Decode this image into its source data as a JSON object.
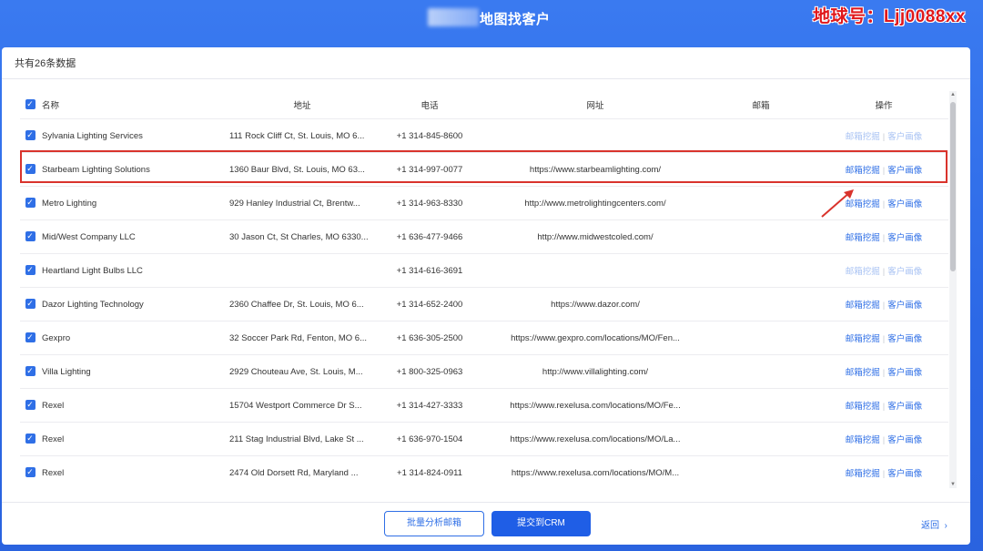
{
  "header": {
    "title": "地图找客户",
    "watermark": "地球号：Ljj0088xx"
  },
  "panel": {
    "summary": "共有26条数据"
  },
  "table": {
    "columns": [
      "名称",
      "地址",
      "电话",
      "网址",
      "邮箱",
      "操作"
    ],
    "op_labels": {
      "mining": "邮箱挖掘",
      "portrait": "客户画像"
    },
    "rows": [
      {
        "name": "Sylvania Lighting Services",
        "address": "111 Rock Cliff Ct, St. Louis, MO 6...",
        "phone": "+1 314-845-8600",
        "url": "",
        "email": "",
        "ops_enabled": false
      },
      {
        "name": "Starbeam Lighting Solutions",
        "address": "1360 Baur Blvd, St. Louis, MO 63...",
        "phone": "+1 314-997-0077",
        "url": "https://www.starbeamlighting.com/",
        "email": "",
        "ops_enabled": true
      },
      {
        "name": "Metro Lighting",
        "address": "929 Hanley Industrial Ct, Brentw...",
        "phone": "+1 314-963-8330",
        "url": "http://www.metrolightingcenters.com/",
        "email": "",
        "ops_enabled": true
      },
      {
        "name": "Mid/West Company LLC",
        "address": "30 Jason Ct, St Charles, MO 6330...",
        "phone": "+1 636-477-9466",
        "url": "http://www.midwestcoled.com/",
        "email": "",
        "ops_enabled": true
      },
      {
        "name": "Heartland Light Bulbs LLC",
        "address": "",
        "phone": "+1 314-616-3691",
        "url": "",
        "email": "",
        "ops_enabled": false
      },
      {
        "name": "Dazor Lighting Technology",
        "address": "2360 Chaffee Dr, St. Louis, MO 6...",
        "phone": "+1 314-652-2400",
        "url": "https://www.dazor.com/",
        "email": "",
        "ops_enabled": true
      },
      {
        "name": "Gexpro",
        "address": "32 Soccer Park Rd, Fenton, MO 6...",
        "phone": "+1 636-305-2500",
        "url": "https://www.gexpro.com/locations/MO/Fen...",
        "email": "",
        "ops_enabled": true
      },
      {
        "name": "Villa Lighting",
        "address": "2929 Chouteau Ave, St. Louis, M...",
        "phone": "+1 800-325-0963",
        "url": "http://www.villalighting.com/",
        "email": "",
        "ops_enabled": true
      },
      {
        "name": "Rexel",
        "address": "15704 Westport Commerce Dr S...",
        "phone": "+1 314-427-3333",
        "url": "https://www.rexelusa.com/locations/MO/Fe...",
        "email": "",
        "ops_enabled": true
      },
      {
        "name": "Rexel",
        "address": "211 Stag Industrial Blvd, Lake St ...",
        "phone": "+1 636-970-1504",
        "url": "https://www.rexelusa.com/locations/MO/La...",
        "email": "",
        "ops_enabled": true
      },
      {
        "name": "Rexel",
        "address": "2474 Old Dorsett Rd, Maryland ...",
        "phone": "+1 314-824-0911",
        "url": "https://www.rexelusa.com/locations/MO/M...",
        "email": "",
        "ops_enabled": true
      }
    ]
  },
  "footer": {
    "batch_button": "批量分析邮箱",
    "submit_button": "提交到CRM",
    "back_link": "返回"
  },
  "colors": {
    "primary": "#2f6fe6",
    "highlight_border": "#d9332c",
    "watermark": "#e0171b"
  }
}
